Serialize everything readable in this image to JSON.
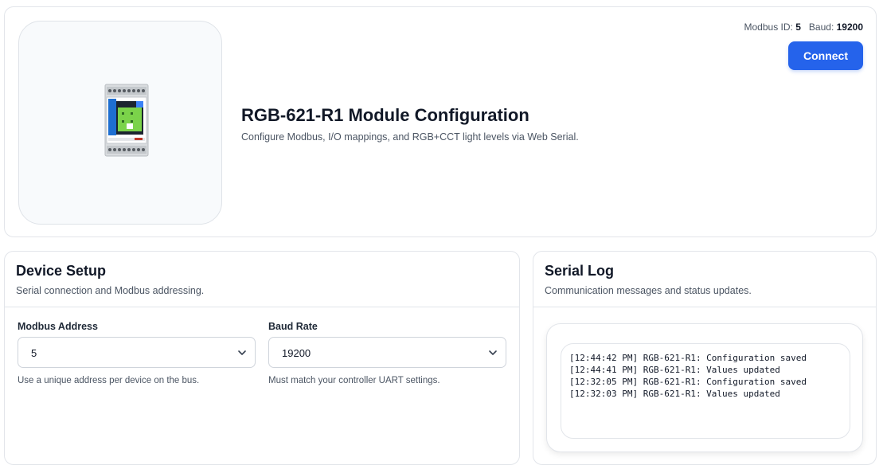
{
  "header": {
    "title": "RGB-621-R1 Module Configuration",
    "subtitle": "Configure Modbus, I/O mappings, and RGB+CCT light levels via Web Serial.",
    "status": {
      "modbus_id_label": "Modbus ID:",
      "modbus_id_value": "5",
      "baud_label": "Baud:",
      "baud_value": "19200"
    },
    "connect_label": "Connect",
    "accent_color": "#2563eb"
  },
  "device_setup": {
    "title": "Device Setup",
    "description": "Serial connection and Modbus addressing.",
    "modbus_address": {
      "label": "Modbus Address",
      "value": "5",
      "help": "Use a unique address per device on the bus."
    },
    "baud_rate": {
      "label": "Baud Rate",
      "value": "19200",
      "help": "Must match your controller UART settings."
    }
  },
  "serial_log": {
    "title": "Serial Log",
    "description": "Communication messages and status updates.",
    "entries": [
      "[12:44:42 PM] RGB-621-R1: Configuration saved",
      "[12:44:41 PM] RGB-621-R1: Values updated",
      "[12:32:05 PM] RGB-621-R1: Configuration saved",
      "[12:32:03 PM] RGB-621-R1: Values updated"
    ]
  }
}
